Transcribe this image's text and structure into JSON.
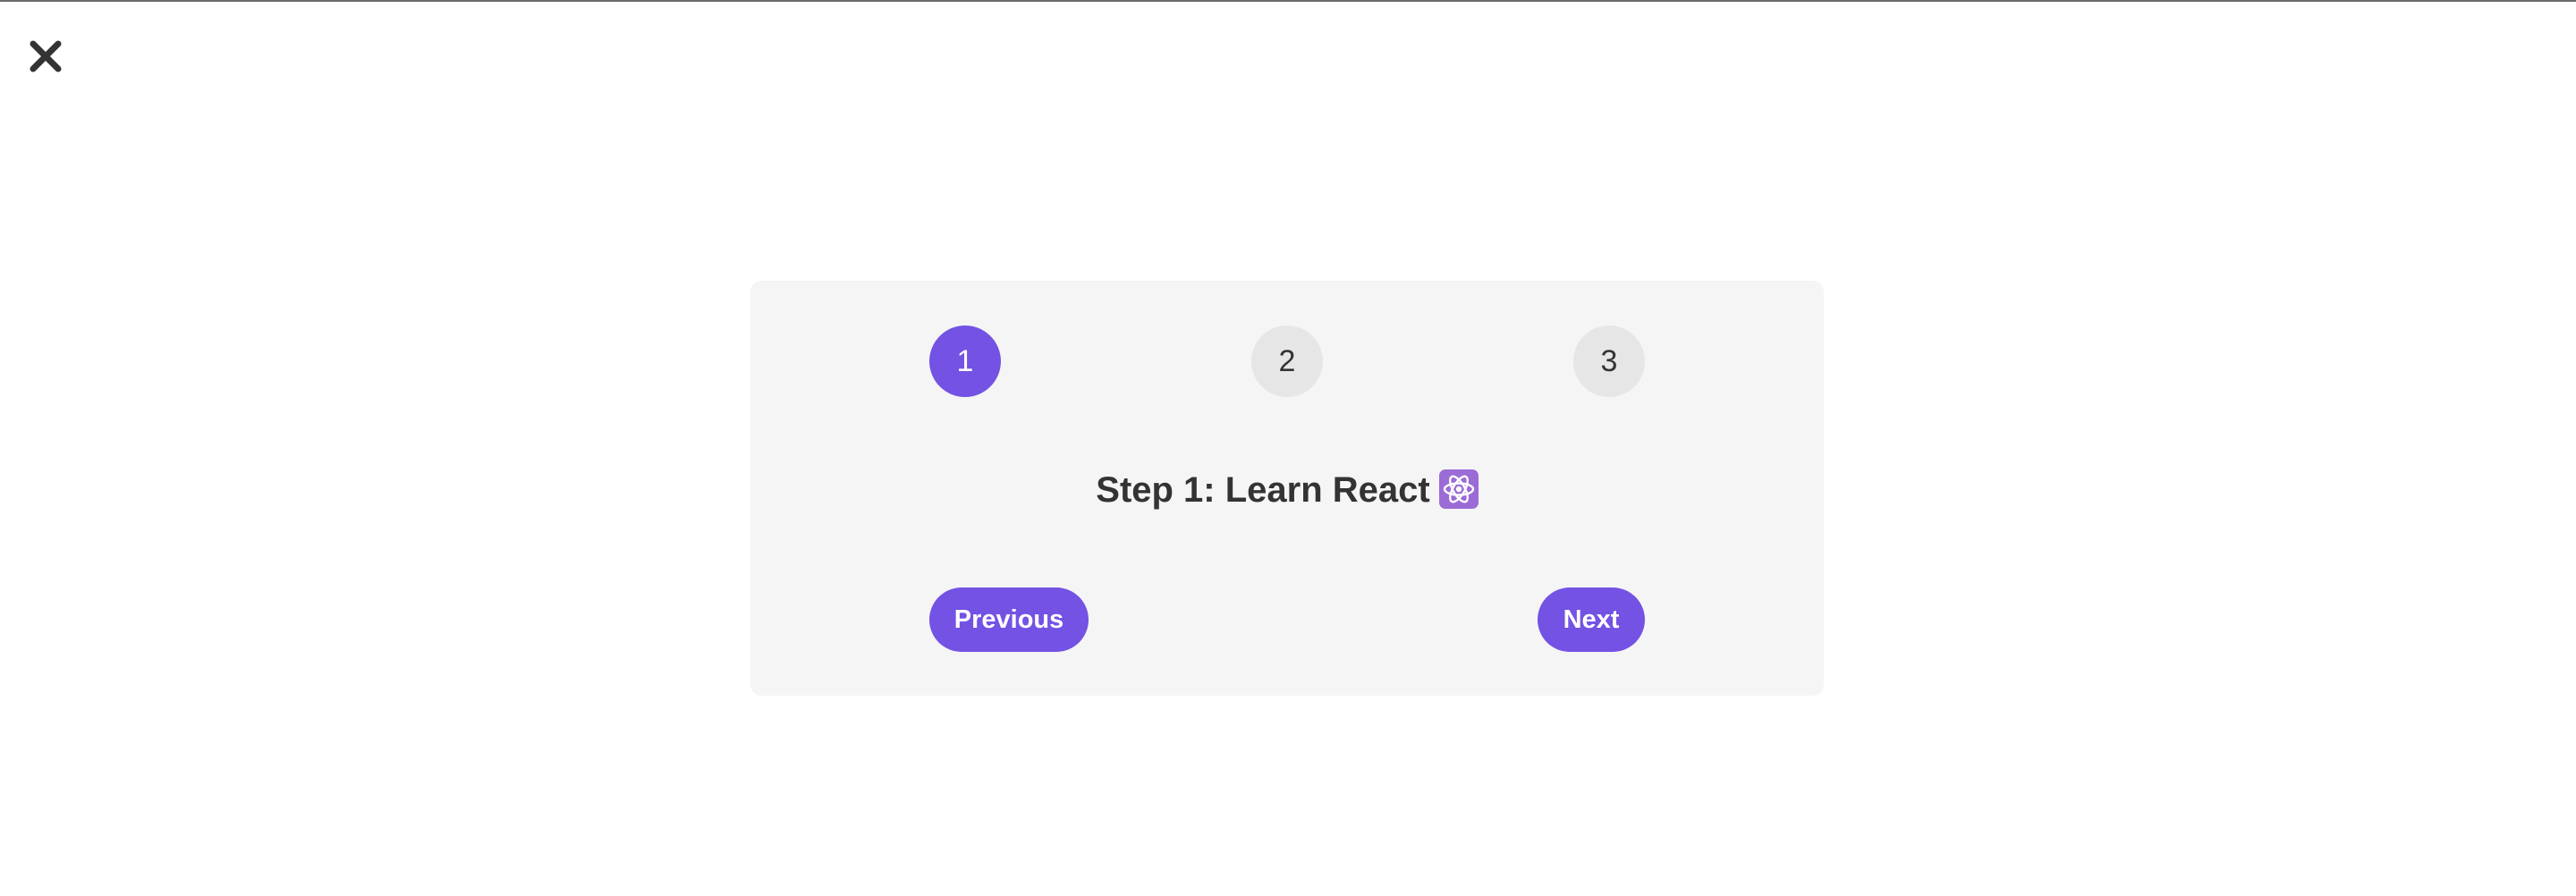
{
  "close_label": "✕",
  "steps": [
    {
      "label": "1",
      "active": true
    },
    {
      "label": "2",
      "active": false
    },
    {
      "label": "3",
      "active": false
    }
  ],
  "step_title": "Step 1: Learn React",
  "title_icon": "atom-icon",
  "buttons": {
    "previous": "Previous",
    "next": "Next"
  },
  "colors": {
    "accent": "#7352e4",
    "card_bg": "#f5f5f5",
    "inactive_step_bg": "#e6e6e6",
    "text": "#333333"
  }
}
